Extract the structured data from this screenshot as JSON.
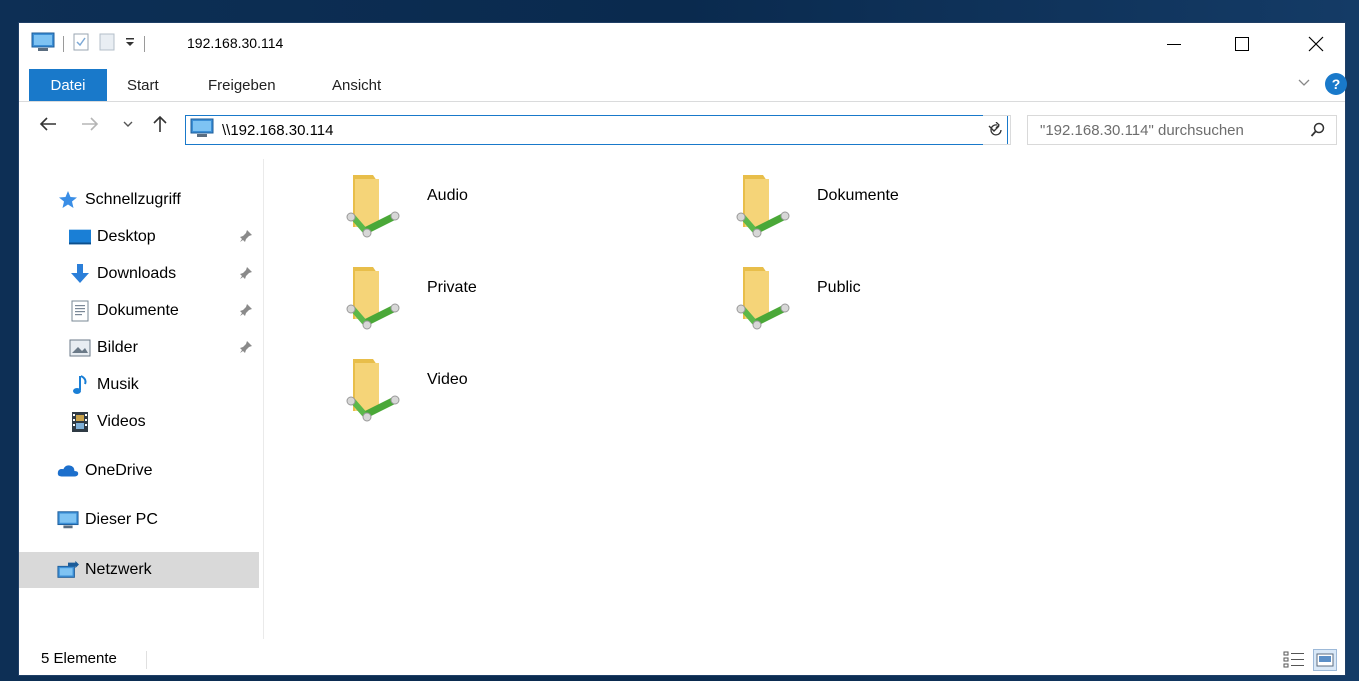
{
  "window": {
    "title": "192.168.30.114"
  },
  "ribbon": {
    "tabs": [
      "Datei",
      "Start",
      "Freigeben",
      "Ansicht"
    ],
    "help_label": "?"
  },
  "navigation": {
    "address": "\\\\192.168.30.114",
    "search_placeholder": "\"192.168.30.114\" durchsuchen"
  },
  "sidebar": {
    "items": [
      {
        "label": "Schnellzugriff",
        "icon": "star-icon"
      },
      {
        "label": "Desktop",
        "icon": "desktop-icon",
        "pinned": true
      },
      {
        "label": "Downloads",
        "icon": "download-arrow-icon",
        "pinned": true
      },
      {
        "label": "Dokumente",
        "icon": "document-icon",
        "pinned": true
      },
      {
        "label": "Bilder",
        "icon": "pictures-icon",
        "pinned": true
      },
      {
        "label": "Musik",
        "icon": "music-note-icon"
      },
      {
        "label": "Videos",
        "icon": "video-icon"
      },
      {
        "label": "OneDrive",
        "icon": "cloud-icon"
      },
      {
        "label": "Dieser PC",
        "icon": "computer-icon"
      },
      {
        "label": "Netzwerk",
        "icon": "network-icon",
        "selected": true
      }
    ]
  },
  "content": {
    "items": [
      {
        "name": "Audio"
      },
      {
        "name": "Dokumente"
      },
      {
        "name": "Private"
      },
      {
        "name": "Public"
      },
      {
        "name": "Video"
      }
    ]
  },
  "status": {
    "count_text": "5 Elemente"
  },
  "colors": {
    "accent": "#1979ca",
    "selection": "#d9d9d9",
    "folder": "#f5d478"
  }
}
